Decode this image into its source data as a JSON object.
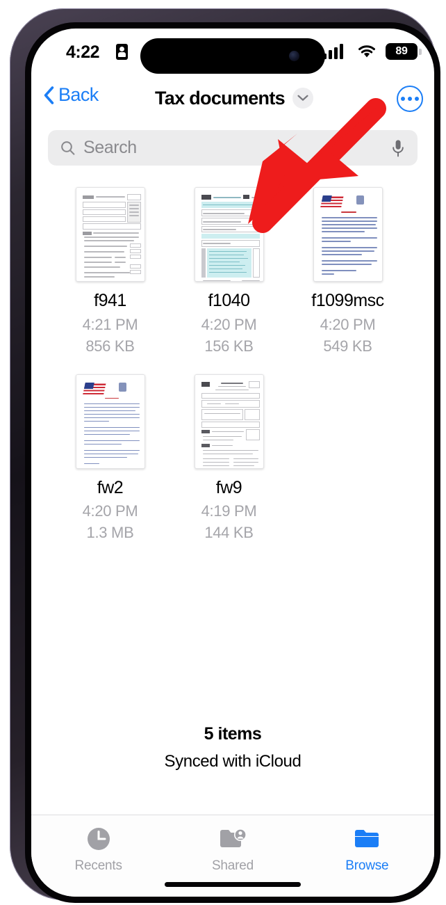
{
  "status_bar": {
    "time": "4:22",
    "badge_icon": "id-badge-icon",
    "signal_icon": "cellular-signal-icon",
    "wifi_icon": "wifi-icon",
    "battery_level": "89"
  },
  "nav_bar": {
    "back_label": "Back",
    "back_icon": "chevron-left-icon",
    "title": "Tax documents",
    "title_chevron_icon": "chevron-down-icon",
    "more_icon": "ellipsis-circle-icon"
  },
  "search": {
    "placeholder": "Search",
    "value": "",
    "search_icon": "search-icon",
    "mic_icon": "microphone-icon"
  },
  "files": [
    {
      "name": "f941",
      "time": "4:21 PM",
      "size": "856 KB",
      "thumb": "irs-form-941"
    },
    {
      "name": "f1040",
      "time": "4:20 PM",
      "size": "156 KB",
      "thumb": "irs-form-1040"
    },
    {
      "name": "f1099msc",
      "time": "4:20 PM",
      "size": "549 KB",
      "thumb": "irs-instructions-flag"
    },
    {
      "name": "fw2",
      "time": "4:20 PM",
      "size": "1.3 MB",
      "thumb": "irs-instructions-flag"
    },
    {
      "name": "fw9",
      "time": "4:19 PM",
      "size": "144 KB",
      "thumb": "irs-form-w9"
    }
  ],
  "footer": {
    "items_count": "5 items",
    "sync_status": "Synced with iCloud"
  },
  "tab_bar": {
    "tabs": [
      {
        "label": "Recents",
        "icon": "clock-icon",
        "active": false
      },
      {
        "label": "Shared",
        "icon": "shared-folder-icon",
        "active": false
      },
      {
        "label": "Browse",
        "icon": "folder-icon",
        "active": true
      }
    ]
  },
  "annotation": {
    "arrow_color": "#ee1c1c",
    "points_to": "ellipsis-circle-icon"
  },
  "colors": {
    "accent_blue": "#1b7ef6",
    "inactive_gray": "#a1a1a6",
    "search_background": "#ececed",
    "annotation_red": "#ee1c1c"
  }
}
